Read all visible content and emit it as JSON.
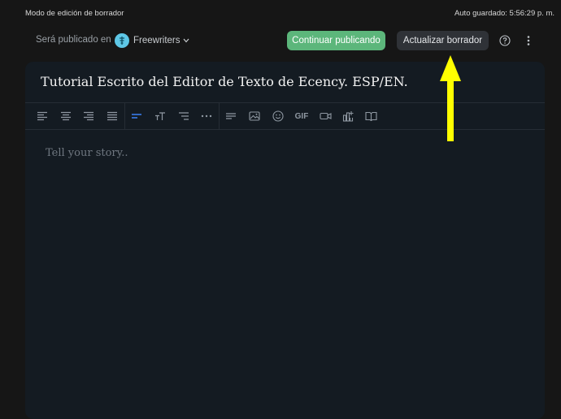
{
  "topbar": {
    "mode_label": "Modo de edición de borrador",
    "autosave": "Auto guardado: 5:56:29 p. m."
  },
  "publish": {
    "prefix": "Será publicado en",
    "community": "Freewriters",
    "community_icon": "feather-icon",
    "continue_label": "Continuar publicando",
    "update_label": "Actualizar borrador",
    "help_icon": "help-circle-icon",
    "more_icon": "more-vertical-icon"
  },
  "editor": {
    "title": "Tutorial Escrito del Editor de Texto de Ecency. ESP/EN.",
    "placeholder": "Tell your story..",
    "toolbar": {
      "gif_label": "GIF",
      "icons": [
        "align-left-icon",
        "align-center-icon",
        "align-right-icon",
        "align-justify-icon",
        "paragraph-icon",
        "text-size-icon",
        "list-icon",
        "more-horizontal-icon",
        "text-wrap-icon",
        "image-icon",
        "emoji-icon",
        "gif-icon",
        "video-icon",
        "chart-icon",
        "book-icon"
      ]
    }
  },
  "colors": {
    "continue_button": "#5cb67b",
    "update_button": "#2f3237",
    "annotation_arrow": "#ffff00",
    "active_tool": "#3b82f6"
  }
}
